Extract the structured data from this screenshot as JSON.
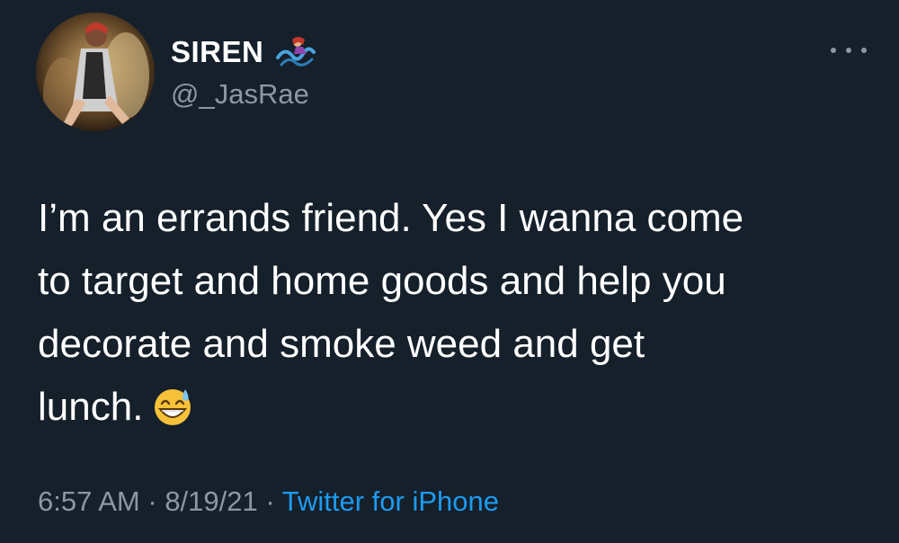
{
  "author": {
    "display_name": "SIREN",
    "handle": "@_JasRae",
    "name_emoji_icon": "mermaid-wave-icon",
    "avatar_icon": "profile-photo"
  },
  "tweet": {
    "lines": [
      "I’m an errands friend. Yes I wanna come",
      "to target and home goods and help you",
      "decorate and smoke weed and get",
      "lunch."
    ],
    "trailing_emoji_icon": "grinning-face-with-sweat-icon"
  },
  "meta": {
    "time": "6:57 AM",
    "separator1": " · ",
    "date": "8/19/21",
    "separator2": " · ",
    "source": "Twitter for iPhone"
  },
  "colors": {
    "background": "#15202b",
    "primary_text": "#ffffff",
    "secondary_text": "#8b98a5",
    "link": "#1d9bf0"
  },
  "more_icon": "more-dots-icon"
}
